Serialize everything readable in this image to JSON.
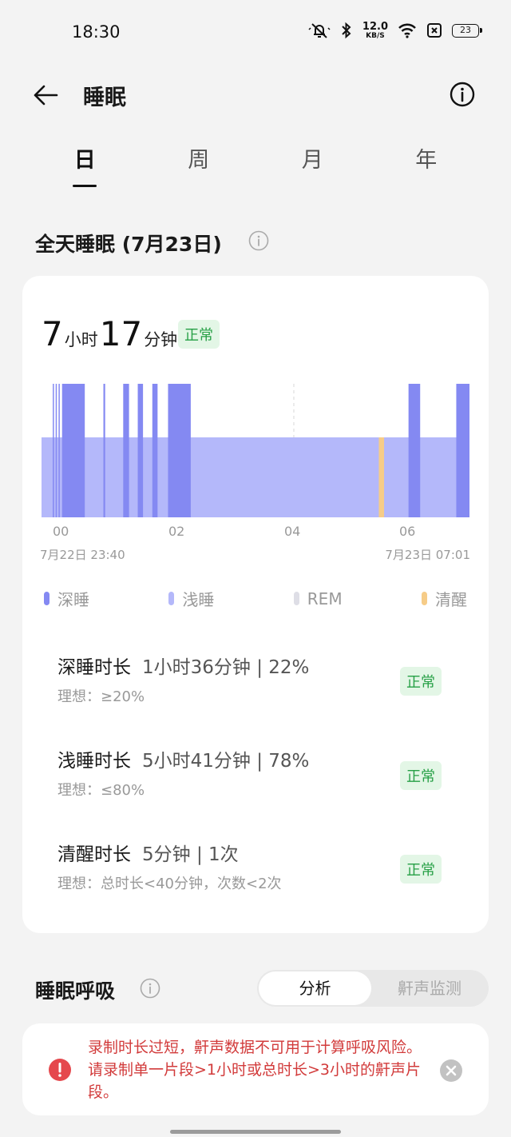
{
  "status_bar": {
    "time": "18:30",
    "speed_value": "12.0",
    "speed_unit": "KB/S",
    "battery": "23"
  },
  "header": {
    "title": "睡眠"
  },
  "tabs": [
    {
      "label": "日"
    },
    {
      "label": "周"
    },
    {
      "label": "月"
    },
    {
      "label": "年"
    }
  ],
  "active_tab": "日",
  "section": {
    "title": "全天睡眠 (7月23日)"
  },
  "summary": {
    "hours": "7",
    "hours_unit": "小时",
    "minutes": "17",
    "minutes_unit": "分钟",
    "status": "正常"
  },
  "chart_data": {
    "type": "hypnogram",
    "x_ticks": [
      "00",
      "02",
      "04",
      "06"
    ],
    "start_label": "7月22日 23:40",
    "end_label": "7月23日 07:01",
    "start_hour": -0.333,
    "end_hour": 7.017,
    "stages": {
      "deep": {
        "color": "#8489f2"
      },
      "light": {
        "color": "#b4b8fa"
      },
      "rem": {
        "color": "#dedee6"
      },
      "awake": {
        "color": "#f6cc88"
      }
    },
    "deep_segments": [
      [
        -0.14,
        -0.12
      ],
      [
        -0.09,
        -0.07
      ],
      [
        -0.04,
        -0.02
      ],
      [
        0.02,
        0.41
      ],
      [
        0.73,
        0.76
      ],
      [
        1.07,
        1.17
      ],
      [
        1.32,
        1.41
      ],
      [
        1.57,
        1.66
      ],
      [
        1.84,
        2.23
      ],
      [
        5.97,
        6.17
      ],
      [
        6.79,
        7.02
      ]
    ],
    "awake_segments": [
      [
        5.46,
        5.55
      ]
    ],
    "marker_hour": 4.0
  },
  "legend": [
    {
      "label": "深睡",
      "color": "#8489f2"
    },
    {
      "label": "浅睡",
      "color": "#b4b8fa"
    },
    {
      "label": "REM",
      "color": "#dedee6"
    },
    {
      "label": "清醒",
      "color": "#f6cc88"
    }
  ],
  "metrics": [
    {
      "title": "深睡时长",
      "value": "1小时36分钟 | 22%",
      "ideal": "理想：≥20%",
      "status": "正常"
    },
    {
      "title": "浅睡时长",
      "value": "5小时41分钟 | 78%",
      "ideal": "理想：≤80%",
      "status": "正常"
    },
    {
      "title": "清醒时长",
      "value": "5分钟 | 1次",
      "ideal": "理想：总时长<40分钟，次数<2次",
      "status": "正常"
    }
  ],
  "breathing": {
    "title": "睡眠呼吸",
    "seg_active": "分析",
    "seg_inactive": "鼾声监测"
  },
  "alert": {
    "text": "录制时长过短，鼾声数据不可用于计算呼吸风险。请录制单一片段>1小时或总时长>3小时的鼾声片段。"
  }
}
